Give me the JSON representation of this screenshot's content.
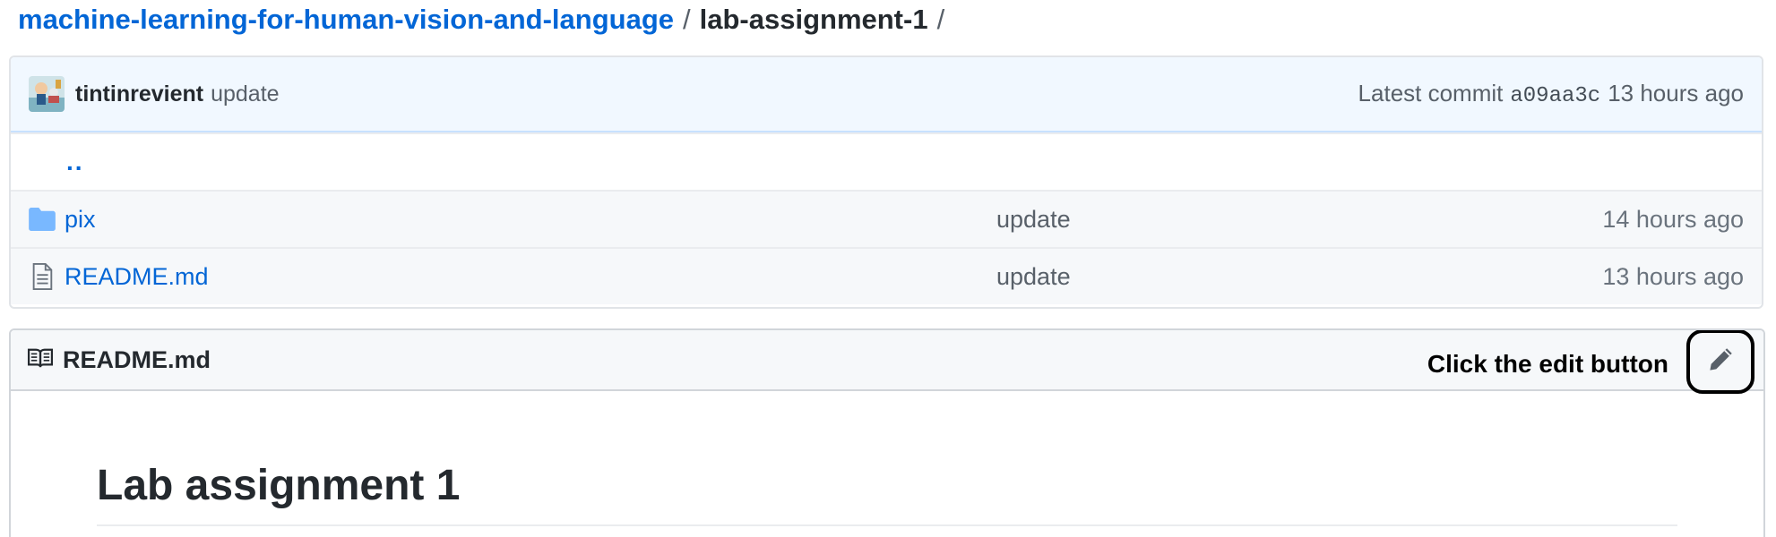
{
  "breadcrumb": {
    "repo": "machine-learning-for-human-vision-and-language",
    "separator": "/",
    "folder": "lab-assignment-1",
    "trailing": "/"
  },
  "commit": {
    "author": "tintinrevient",
    "message": "update",
    "latest_label": "Latest commit",
    "sha": "a09aa3c",
    "age": "13 hours ago"
  },
  "files": {
    "up_label": "..",
    "rows": [
      {
        "name": "pix",
        "type": "folder",
        "message": "update",
        "age": "14 hours ago"
      },
      {
        "name": "README.md",
        "type": "file",
        "message": "update",
        "age": "13 hours ago"
      }
    ]
  },
  "readme": {
    "title": "README.md",
    "annotation": "Click the edit button",
    "heading": "Lab assignment 1"
  },
  "colors": {
    "link": "#0366d6",
    "commit_bar_bg": "#f1f8ff",
    "folder_icon": "#79b8ff"
  },
  "icons": {
    "folder": "folder-icon",
    "file": "file-icon",
    "book": "book-icon",
    "edit": "pencil-icon"
  }
}
